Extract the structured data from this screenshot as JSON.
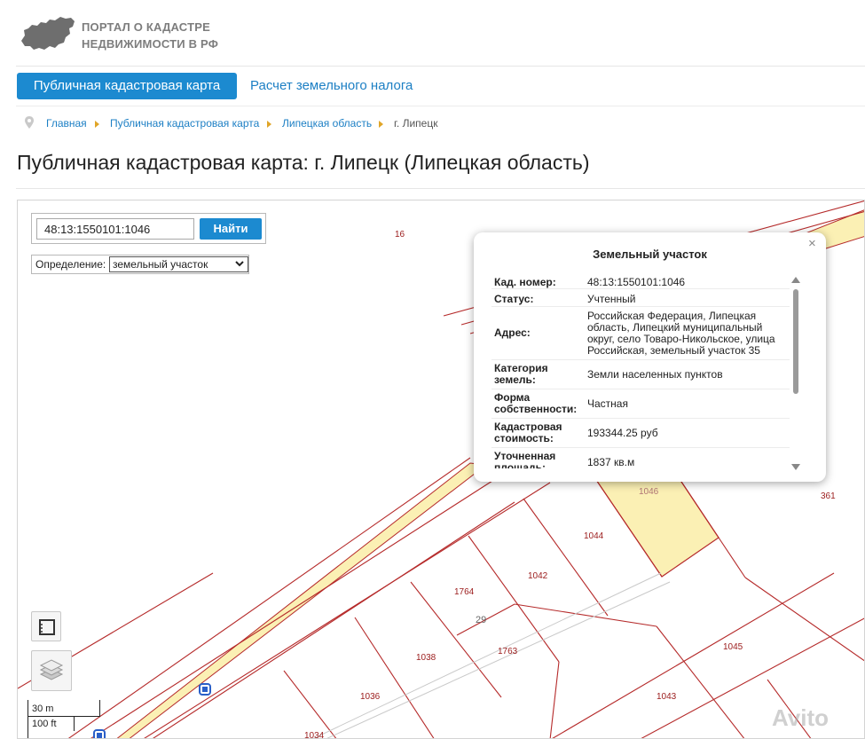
{
  "header": {
    "logo_line1": "ПОРТАЛ О КАДАСТРЕ",
    "logo_line2": "НЕДВИЖИМОСТИ В РФ",
    "logo_icon": "russia-map-icon"
  },
  "nav": {
    "tabs": [
      {
        "label": "Публичная кадастровая карта",
        "active": true
      },
      {
        "label": "Расчет земельного налога",
        "active": false
      }
    ]
  },
  "breadcrumbs": [
    "Главная",
    "Публичная кадастровая карта",
    "Липецкая область",
    "г. Липецк"
  ],
  "page_title": "Публичная кадастровая карта: г. Липецк (Липецкая область)",
  "search": {
    "value": "48:13:1550101:1046",
    "button_label": "Найти",
    "definition_label": "Определение:",
    "definition_value": "земельный участок"
  },
  "popup": {
    "title": "Земельный участок",
    "close": "×",
    "rows": [
      {
        "key": "Кад. номер:",
        "value": "48:13:1550101:1046"
      },
      {
        "key": "Статус:",
        "value": "Учтенный"
      },
      {
        "key": "Адрес:",
        "value": "Российская Федерация, Липецкая область, Липецкий муниципальный округ, село Товаро-Никольское, улица Российская, земельный участок 35"
      },
      {
        "key": "Категория земель:",
        "value": "Земли населенных пунктов"
      },
      {
        "key": "Форма собственности:",
        "value": "Частная"
      },
      {
        "key": "Кадастровая стоимость:",
        "value": "193344.25 руб"
      },
      {
        "key": "Уточненная площадь:",
        "value": "1837 кв.м"
      }
    ]
  },
  "map": {
    "parcel_labels": [
      "16",
      "1046",
      "361",
      "1044",
      "1042",
      "1764",
      "29",
      "1038",
      "1763",
      "1045",
      "1036",
      "1043",
      "1034"
    ],
    "scale_metric": "30 m",
    "scale_imperial": "100 ft",
    "watermark": "Avito",
    "colors": {
      "boundary": "#b52a2a",
      "highlight": "#fbf0b4",
      "accent": "#1c8ad0"
    }
  }
}
